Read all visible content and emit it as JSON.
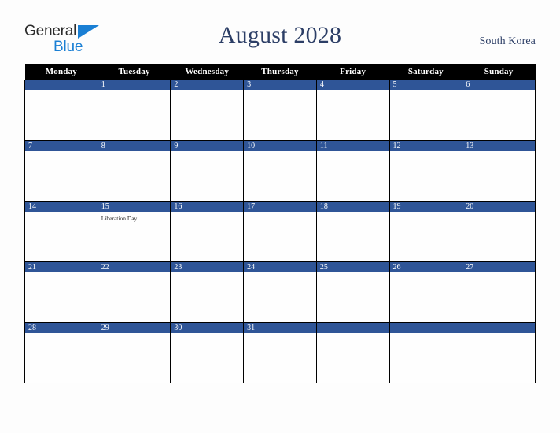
{
  "brand": {
    "name_part1": "General",
    "name_part2": "Blue",
    "triangle_color": "#1a7fd4",
    "text_color": "#2b2b2b"
  },
  "header": {
    "title": "August 2028",
    "country": "South Korea",
    "title_color": "#2c3e66"
  },
  "calendar": {
    "month": "August",
    "year": "2028",
    "accent_color": "#2f5597",
    "header_bg": "#000000",
    "weekday_headers": [
      "Monday",
      "Tuesday",
      "Wednesday",
      "Thursday",
      "Friday",
      "Saturday",
      "Sunday"
    ],
    "weeks": [
      [
        {
          "day": "",
          "events": []
        },
        {
          "day": "1",
          "events": []
        },
        {
          "day": "2",
          "events": []
        },
        {
          "day": "3",
          "events": []
        },
        {
          "day": "4",
          "events": []
        },
        {
          "day": "5",
          "events": []
        },
        {
          "day": "6",
          "events": []
        }
      ],
      [
        {
          "day": "7",
          "events": []
        },
        {
          "day": "8",
          "events": []
        },
        {
          "day": "9",
          "events": []
        },
        {
          "day": "10",
          "events": []
        },
        {
          "day": "11",
          "events": []
        },
        {
          "day": "12",
          "events": []
        },
        {
          "day": "13",
          "events": []
        }
      ],
      [
        {
          "day": "14",
          "events": []
        },
        {
          "day": "15",
          "events": [
            "Liberation Day"
          ]
        },
        {
          "day": "16",
          "events": []
        },
        {
          "day": "17",
          "events": []
        },
        {
          "day": "18",
          "events": []
        },
        {
          "day": "19",
          "events": []
        },
        {
          "day": "20",
          "events": []
        }
      ],
      [
        {
          "day": "21",
          "events": []
        },
        {
          "day": "22",
          "events": []
        },
        {
          "day": "23",
          "events": []
        },
        {
          "day": "24",
          "events": []
        },
        {
          "day": "25",
          "events": []
        },
        {
          "day": "26",
          "events": []
        },
        {
          "day": "27",
          "events": []
        }
      ],
      [
        {
          "day": "28",
          "events": []
        },
        {
          "day": "29",
          "events": []
        },
        {
          "day": "30",
          "events": []
        },
        {
          "day": "31",
          "events": []
        },
        {
          "day": "",
          "events": []
        },
        {
          "day": "",
          "events": []
        },
        {
          "day": "",
          "events": []
        }
      ]
    ]
  }
}
